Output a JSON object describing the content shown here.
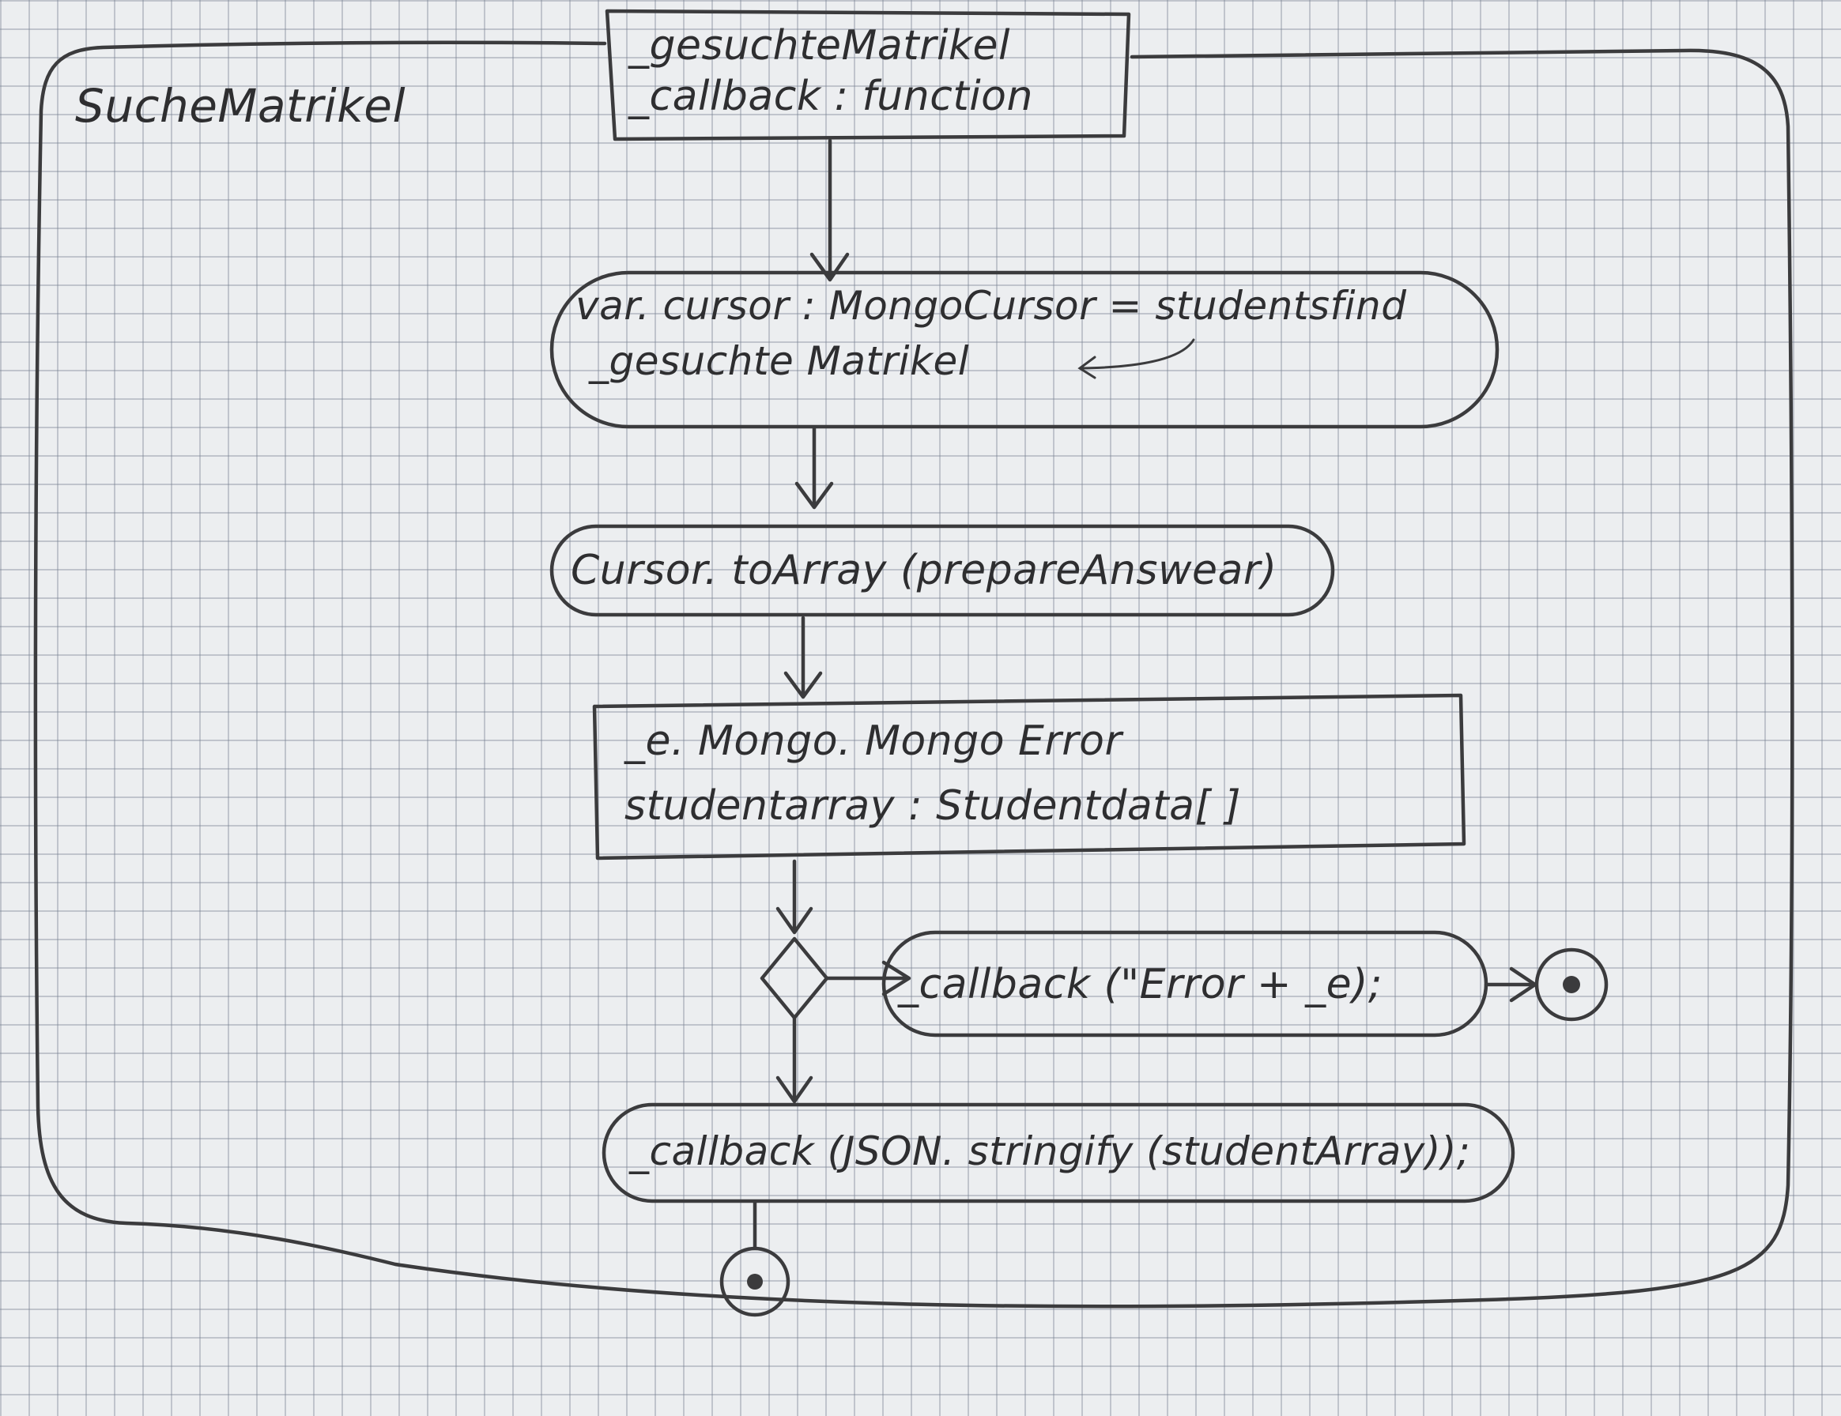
{
  "activity": {
    "name": "SucheMatrikel"
  },
  "parameter_node": {
    "lines": [
      "_gesuchteMatrikel",
      "_callback : function"
    ]
  },
  "actions": {
    "cursor_find": {
      "lines": [
        "var. cursor : MongoCursor = studentsfind",
        "_gesuchte Matrikel"
      ]
    },
    "to_array": {
      "text": "Cursor. toArray (prepareAnswear)"
    },
    "callback_error": {
      "text": "_callback (\"Error + _e);"
    },
    "callback_json": {
      "text": "_callback (JSON. stringify (studentArray));"
    }
  },
  "object_node": {
    "lines": [
      "_e. Mongo. Mongo Error",
      "studentarray : Studentdata[ ]"
    ]
  },
  "final_nodes": [
    "final-node-error",
    "final-node-end"
  ],
  "ink_color": "#3b3b3d"
}
